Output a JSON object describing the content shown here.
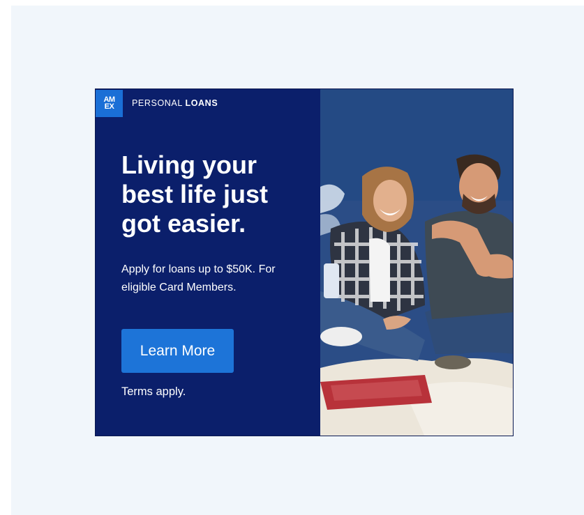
{
  "ad": {
    "logo": {
      "lines": [
        "AM",
        "EX"
      ],
      "color": "#1a6fd6"
    },
    "brand": {
      "light": "PERSONAL",
      "bold": "LOANS"
    },
    "headline": "Living your best life just got easier.",
    "subcopy": "Apply for loans up to $50K. For eligible Card Members.",
    "cta_label": "Learn More",
    "terms": "Terms apply.",
    "colors": {
      "panel": "#0b1f6b",
      "cta": "#1d74d8",
      "page_background": "#f1f6fb"
    },
    "photo": {
      "icon": "couple-photo-image"
    }
  }
}
